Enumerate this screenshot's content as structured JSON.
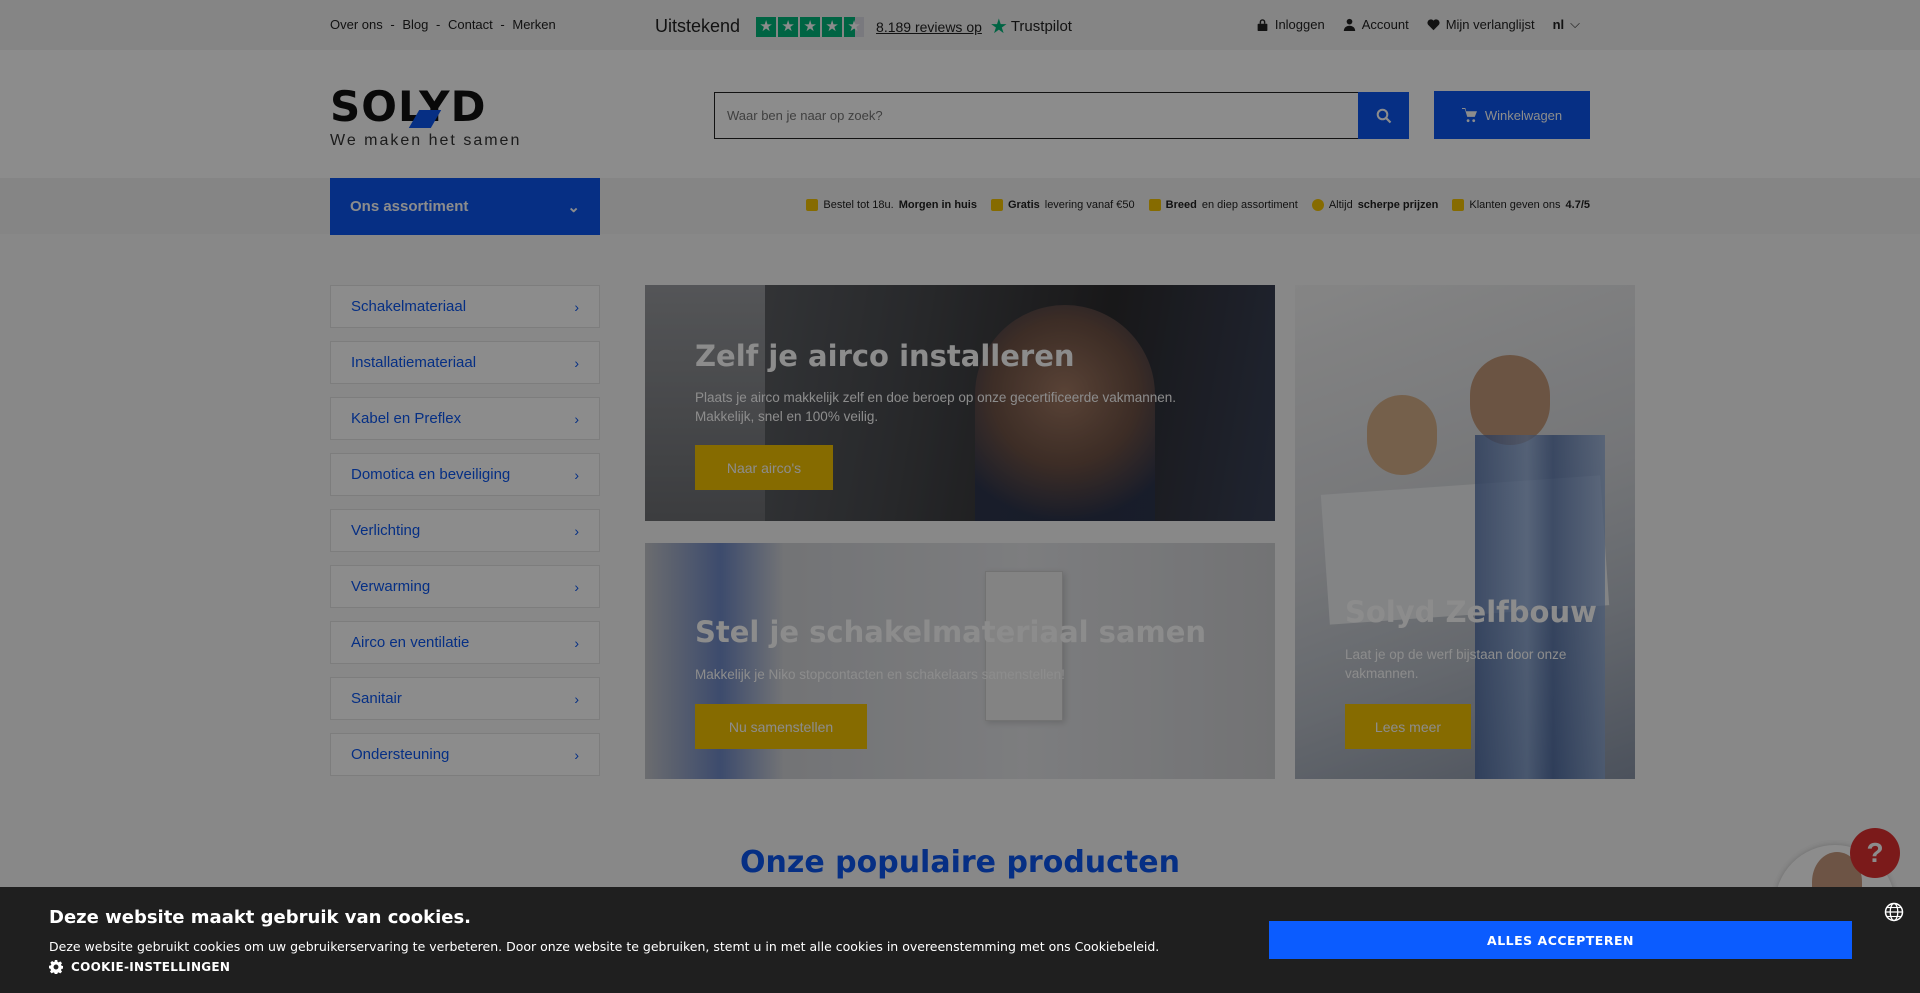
{
  "topbar": {
    "links": [
      "Over ons",
      "Blog",
      "Contact",
      "Merken"
    ],
    "separator": "-",
    "trustpilot": {
      "rating_word": "Uitstekend",
      "stars": 4.5,
      "reviews_text": "8.189 reviews op",
      "brand": "Trustpilot",
      "color": "#00b67a"
    },
    "account": {
      "login": "Inloggen",
      "account": "Account",
      "wishlist": "Mijn verlanglijst",
      "language": "nl"
    }
  },
  "header": {
    "logo_text": "SOLYD",
    "tagline": "We maken het samen",
    "search_placeholder": "Waar ben je naar op zoek?",
    "cart_label": "Winkelwagen",
    "accent_color": "#0b57f0"
  },
  "nav": {
    "assortment_label": "Ons assortiment",
    "usps": [
      {
        "pre": "Bestel tot 18u.",
        "bold": "Morgen in huis",
        "post": ""
      },
      {
        "pre": "",
        "bold": "Gratis",
        "post": "levering vanaf €50"
      },
      {
        "pre": "",
        "bold": "Breed",
        "post": "en diep assortiment"
      },
      {
        "pre": "Altijd",
        "bold": "scherpe prijzen",
        "post": ""
      },
      {
        "pre": "Klanten geven ons",
        "bold": "4.7/5",
        "post": ""
      }
    ]
  },
  "categories": [
    "Schakelmateriaal",
    "Installatiemateriaal",
    "Kabel en Preflex",
    "Domotica en beveiliging",
    "Verlichting",
    "Verwarming",
    "Airco en ventilatie",
    "Sanitair",
    "Ondersteuning"
  ],
  "banners": {
    "airco": {
      "title": "Zelf je airco installeren",
      "text": "Plaats je airco makkelijk zelf en doe beroep op onze gecertificeerde vakmannen. Makkelijk, snel en 100% veilig.",
      "button": "Naar airco's"
    },
    "schakel": {
      "title": "Stel je schakelmateriaal samen",
      "text": "Makkelijk je Niko stopcontacten en schakelaars samenstellen!",
      "button": "Nu samenstellen"
    },
    "zelfbouw": {
      "title": "Solyd Zelfbouw",
      "text": "Laat je op de werf bijstaan door onze vakmannen.",
      "button": "Lees meer"
    },
    "button_color": "#f4c400"
  },
  "section_title": "Onze populaire producten",
  "help_label": "?",
  "cookie": {
    "title": "Deze website maakt gebruik van cookies.",
    "text": "Deze website gebruikt cookies om uw gebruikerservaring te verbeteren. Door onze website te gebruiken, stemt u in met alle cookies in overeenstemming met ons Cookiebeleid.",
    "settings": "COOKIE-INSTELLINGEN",
    "accept": "ALLES ACCEPTEREN",
    "accept_color": "#0b5cff"
  }
}
